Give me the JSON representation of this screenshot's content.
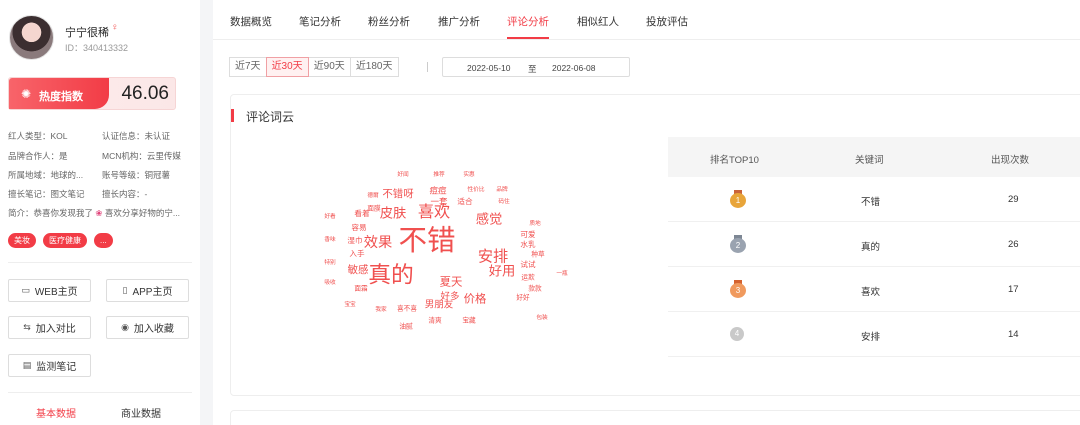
{
  "profile": {
    "name": "宁宁很稀",
    "id_text": "ID：340413332",
    "index_label": "热度指数",
    "index_value": "46.06",
    "info": [
      {
        "label": "红人类型：",
        "value": "KOL"
      },
      {
        "label": "认证信息：",
        "value": "未认证"
      },
      {
        "label": "品牌合作人：",
        "value": "是"
      },
      {
        "label": "MCN机构：",
        "value": "云里传媒"
      },
      {
        "label": "所属地域：",
        "value": "地球的..."
      },
      {
        "label": "账号等级：",
        "value": "铜冠薯"
      },
      {
        "label": "擅长笔记：",
        "value": "图文笔记"
      },
      {
        "label": "擅长内容：",
        "value": "-"
      }
    ],
    "bio_label": "简介：",
    "bio_text": "恭喜你发现我了",
    "bio_text2": "喜欢分享好物的宁...",
    "tags": [
      "美妆",
      "医疗健康",
      "..."
    ],
    "buttons": {
      "web": "WEB主页",
      "app": "APP主页",
      "compare": "加入对比",
      "favorite": "加入收藏",
      "monitor": "监测笔记"
    },
    "bottom_tabs": [
      "基本数据",
      "商业数据"
    ]
  },
  "nav": {
    "tabs": [
      "数据概览",
      "笔记分析",
      "粉丝分析",
      "推广分析",
      "评论分析",
      "相似红人",
      "投放评估"
    ],
    "active_index": 4
  },
  "filters": {
    "ranges": [
      "近7天",
      "近30天",
      "近90天",
      "近180天"
    ],
    "active_index": 1,
    "start_date": "2022-05-10",
    "sep": "至",
    "end_date": "2022-06-08"
  },
  "section": {
    "title": "评论词云",
    "words": [
      {
        "t": "不错",
        "s": 30
      },
      {
        "t": "真的",
        "s": 24
      },
      {
        "t": "喜欢",
        "s": 17
      },
      {
        "t": "安排",
        "s": 16
      },
      {
        "t": "效果",
        "s": 15
      },
      {
        "t": "皮肤",
        "s": 14
      },
      {
        "t": "感觉",
        "s": 14
      },
      {
        "t": "好用",
        "s": 14
      },
      {
        "t": "夏天",
        "s": 12
      },
      {
        "t": "价格",
        "s": 12
      },
      {
        "t": "不错呀",
        "s": 11
      },
      {
        "t": "敏感",
        "s": 11
      },
      {
        "t": "男朋友",
        "s": 10
      },
      {
        "t": "好多",
        "s": 10
      },
      {
        "t": "痘痘",
        "s": 9
      },
      {
        "t": "一套",
        "s": 9
      },
      {
        "t": "适合",
        "s": 8
      },
      {
        "t": "看着",
        "s": 8
      },
      {
        "t": "容易",
        "s": 8
      },
      {
        "t": "湿巾",
        "s": 8
      },
      {
        "t": "入手",
        "s": 8
      },
      {
        "t": "可爱",
        "s": 8
      },
      {
        "t": "水乳",
        "s": 8
      },
      {
        "t": "试试",
        "s": 8
      },
      {
        "t": "运欺",
        "s": 7
      },
      {
        "t": "款款",
        "s": 7
      },
      {
        "t": "种草",
        "s": 7
      },
      {
        "t": "好好",
        "s": 7
      },
      {
        "t": "面霜",
        "s": 7
      },
      {
        "t": "面膜",
        "s": 7
      },
      {
        "t": "喜不喜",
        "s": 7
      },
      {
        "t": "清爽",
        "s": 7
      },
      {
        "t": "宝藏",
        "s": 7
      },
      {
        "t": "油腻",
        "s": 7
      },
      {
        "t": "我家",
        "s": 6
      },
      {
        "t": "宝宝",
        "s": 6
      },
      {
        "t": "吸收",
        "s": 6
      },
      {
        "t": "特别",
        "s": 6
      },
      {
        "t": "香味",
        "s": 6
      },
      {
        "t": "好看",
        "s": 6
      },
      {
        "t": "德爾",
        "s": 6
      },
      {
        "t": "好闻",
        "s": 6
      },
      {
        "t": "推荐",
        "s": 6
      },
      {
        "t": "实惠",
        "s": 6
      },
      {
        "t": "性价比",
        "s": 6
      },
      {
        "t": "码住",
        "s": 6
      },
      {
        "t": "品牌",
        "s": 6
      },
      {
        "t": "质地",
        "s": 6
      },
      {
        "t": "一瓶",
        "s": 6
      },
      {
        "t": "包装",
        "s": 6
      }
    ]
  },
  "table": {
    "headers": [
      "排名TOP10",
      "关键词",
      "出现次数"
    ],
    "rows": [
      {
        "rank": "1",
        "keyword": "不错",
        "count": "29"
      },
      {
        "rank": "2",
        "keyword": "真的",
        "count": "26"
      },
      {
        "rank": "3",
        "keyword": "喜欢",
        "count": "17"
      },
      {
        "rank": "4",
        "keyword": "安排",
        "count": "14"
      }
    ]
  },
  "colors": {
    "accent": "#f23c46",
    "word": "#f0504f",
    "gold": "#e8a53a",
    "silver": "#9aa3b0",
    "bronze": "#f09a5e"
  }
}
